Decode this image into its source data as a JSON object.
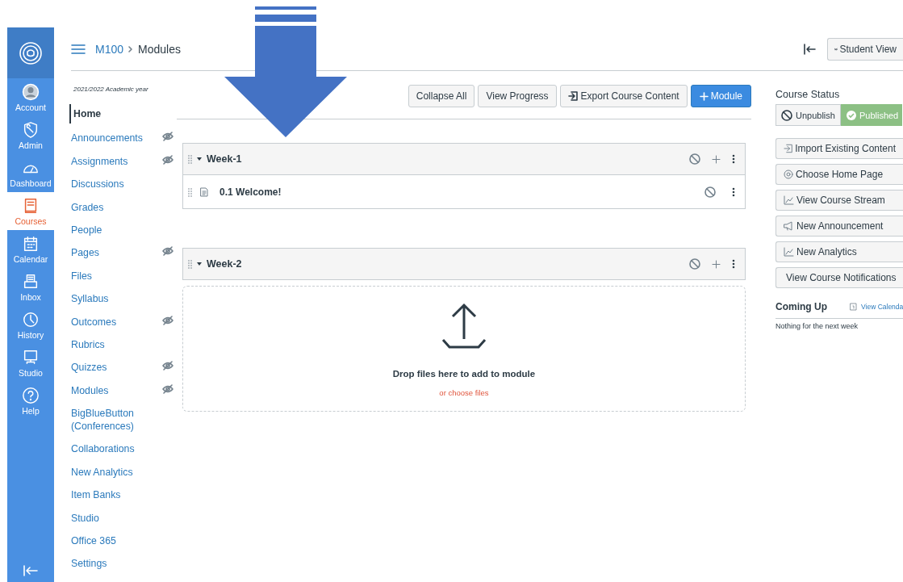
{
  "global_nav": {
    "items": [
      {
        "label": "Account",
        "kind": "avatar",
        "selected": false
      },
      {
        "label": "Admin",
        "kind": "admin",
        "selected": false
      },
      {
        "label": "Dashboard",
        "kind": "dashboard",
        "selected": false
      },
      {
        "label": "Courses",
        "kind": "courses",
        "selected": true
      },
      {
        "label": "Calendar",
        "kind": "calendar",
        "selected": false
      },
      {
        "label": "Inbox",
        "kind": "inbox",
        "selected": false
      },
      {
        "label": "History",
        "kind": "history",
        "selected": false
      },
      {
        "label": "Studio",
        "kind": "studio",
        "selected": false
      },
      {
        "label": "Help",
        "kind": "help",
        "selected": false
      }
    ]
  },
  "header": {
    "breadcrumb": [
      "M100",
      "Modules"
    ],
    "student_view": "Student View"
  },
  "course_nav": {
    "term": "2021/2022 Academic year",
    "items": [
      {
        "label": "Home",
        "selected": true,
        "hidden": false
      },
      {
        "label": "Announcements",
        "selected": false,
        "hidden": true
      },
      {
        "label": "Assignments",
        "selected": false,
        "hidden": true
      },
      {
        "label": "Discussions",
        "selected": false,
        "hidden": false
      },
      {
        "label": "Grades",
        "selected": false,
        "hidden": false
      },
      {
        "label": "People",
        "selected": false,
        "hidden": false
      },
      {
        "label": "Pages",
        "selected": false,
        "hidden": true
      },
      {
        "label": "Files",
        "selected": false,
        "hidden": false
      },
      {
        "label": "Syllabus",
        "selected": false,
        "hidden": false
      },
      {
        "label": "Outcomes",
        "selected": false,
        "hidden": true
      },
      {
        "label": "Rubrics",
        "selected": false,
        "hidden": false
      },
      {
        "label": "Quizzes",
        "selected": false,
        "hidden": true
      },
      {
        "label": "Modules",
        "selected": false,
        "hidden": true
      },
      {
        "label": "BigBlueButton (Conferences)",
        "selected": false,
        "hidden": false
      },
      {
        "label": "Collaborations",
        "selected": false,
        "hidden": false
      },
      {
        "label": "New Analytics",
        "selected": false,
        "hidden": false
      },
      {
        "label": "Item Banks",
        "selected": false,
        "hidden": false
      },
      {
        "label": "Studio",
        "selected": false,
        "hidden": false
      },
      {
        "label": "Office 365",
        "selected": false,
        "hidden": false
      },
      {
        "label": "Settings",
        "selected": false,
        "hidden": false
      }
    ]
  },
  "toolbar": [
    {
      "label": "Collapse All",
      "kind": "plain"
    },
    {
      "label": "View Progress",
      "kind": "plain"
    },
    {
      "label": "Export Course Content",
      "kind": "export"
    },
    {
      "label": "Module",
      "kind": "add"
    }
  ],
  "modules": [
    {
      "title": "Week-1",
      "expanded": true,
      "items": [
        {
          "title": "0.1 Welcome!"
        }
      ]
    },
    {
      "title": "Week-2",
      "expanded": true,
      "dropzone": {
        "text": "Drop files here to add to module",
        "link": "or choose files"
      }
    }
  ],
  "sidebar": {
    "course_status": {
      "title": "Course Status",
      "options": [
        {
          "label": "Unpublish",
          "selected": false
        },
        {
          "label": "Published",
          "selected": true
        }
      ]
    },
    "actions": [
      {
        "label": "Import Existing Content",
        "kind": "import"
      },
      {
        "label": "Choose Home Page",
        "kind": "home"
      },
      {
        "label": "View Course Stream",
        "kind": "stream"
      },
      {
        "label": "New Announcement",
        "kind": "announce"
      },
      {
        "label": "New Analytics",
        "kind": "analytics"
      },
      {
        "label": "View Course Notifications",
        "kind": "bell"
      }
    ],
    "coming_up": {
      "title": "Coming Up",
      "link": "View Calenda",
      "empty_text": "Nothing for the next week"
    }
  }
}
